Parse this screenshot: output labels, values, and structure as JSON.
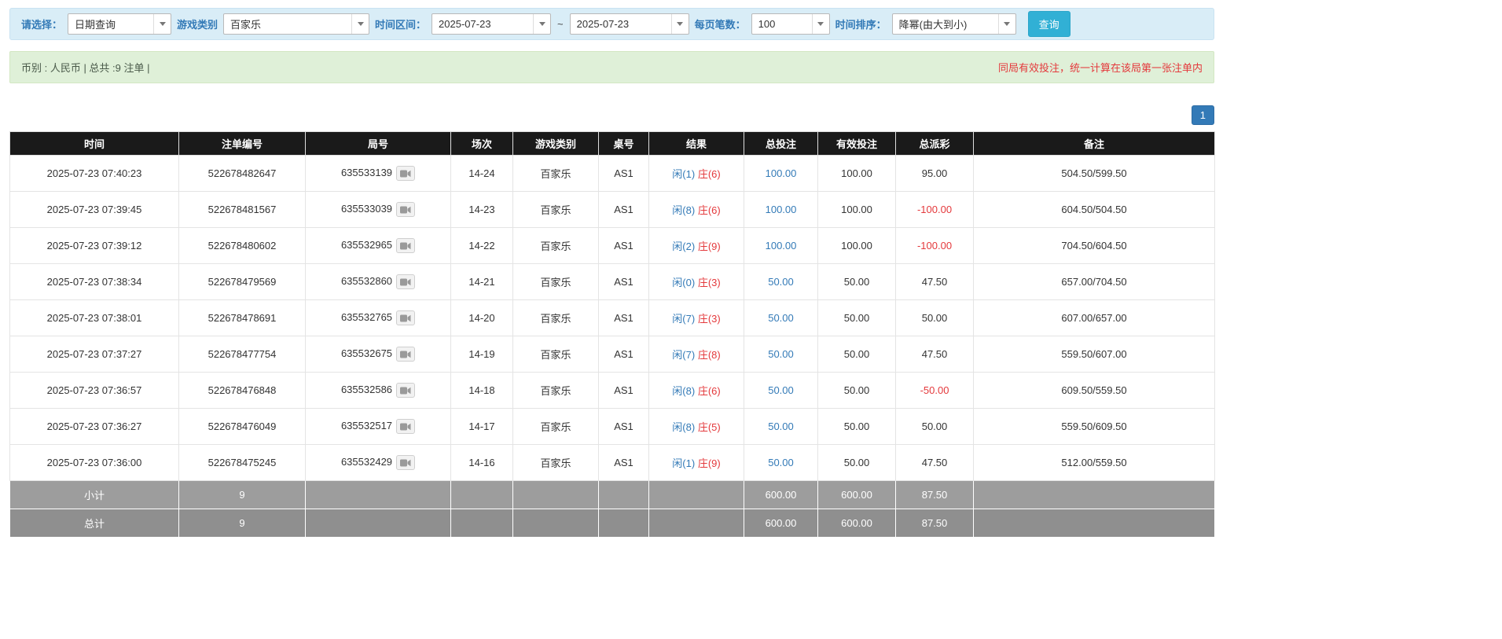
{
  "colors": {
    "accent_blue": "#337ab7",
    "status_red": "#e4393c",
    "button_cyan": "#31b0d5",
    "header_black": "#1a1a1a"
  },
  "filters": {
    "select_label": "请选择：",
    "select_value": "日期查询",
    "game_type_label": "游戏类别",
    "game_type_value": "百家乐",
    "time_range_label": "时间区间：",
    "date_from": "2025-07-23",
    "range_separator": "~",
    "date_to": "2025-07-23",
    "page_size_label": "每页笔数：",
    "page_size_value": "100",
    "sort_label": "时间排序：",
    "sort_value": "降幂(由大到小)",
    "search_button": "查询"
  },
  "summary": {
    "left": "币别 : 人民币 | 总共 :9 注单 |",
    "right": "同局有效投注，统一计算在该局第一张注单内"
  },
  "pagination": {
    "current": "1"
  },
  "table": {
    "headers": [
      "时间",
      "注单编号",
      "局号",
      "场次",
      "游戏类别",
      "桌号",
      "结果",
      "总投注",
      "有效投注",
      "总派彩",
      "备注"
    ],
    "rows": [
      {
        "time": "2025-07-23 07:40:23",
        "bet_id": "522678482647",
        "round_id": "635533139",
        "session": "14-24",
        "game": "百家乐",
        "table": "AS1",
        "player": "闲(1)",
        "banker": "庄(6)",
        "total_bet": "100.00",
        "valid_bet": "100.00",
        "payout": "95.00",
        "remark": "504.50/599.50"
      },
      {
        "time": "2025-07-23 07:39:45",
        "bet_id": "522678481567",
        "round_id": "635533039",
        "session": "14-23",
        "game": "百家乐",
        "table": "AS1",
        "player": "闲(8)",
        "banker": "庄(6)",
        "total_bet": "100.00",
        "valid_bet": "100.00",
        "payout": "-100.00",
        "remark": "604.50/504.50"
      },
      {
        "time": "2025-07-23 07:39:12",
        "bet_id": "522678480602",
        "round_id": "635532965",
        "session": "14-22",
        "game": "百家乐",
        "table": "AS1",
        "player": "闲(2)",
        "banker": "庄(9)",
        "total_bet": "100.00",
        "valid_bet": "100.00",
        "payout": "-100.00",
        "remark": "704.50/604.50"
      },
      {
        "time": "2025-07-23 07:38:34",
        "bet_id": "522678479569",
        "round_id": "635532860",
        "session": "14-21",
        "game": "百家乐",
        "table": "AS1",
        "player": "闲(0)",
        "banker": "庄(3)",
        "total_bet": "50.00",
        "valid_bet": "50.00",
        "payout": "47.50",
        "remark": "657.00/704.50"
      },
      {
        "time": "2025-07-23 07:38:01",
        "bet_id": "522678478691",
        "round_id": "635532765",
        "session": "14-20",
        "game": "百家乐",
        "table": "AS1",
        "player": "闲(7)",
        "banker": "庄(3)",
        "total_bet": "50.00",
        "valid_bet": "50.00",
        "payout": "50.00",
        "remark": "607.00/657.00"
      },
      {
        "time": "2025-07-23 07:37:27",
        "bet_id": "522678477754",
        "round_id": "635532675",
        "session": "14-19",
        "game": "百家乐",
        "table": "AS1",
        "player": "闲(7)",
        "banker": "庄(8)",
        "total_bet": "50.00",
        "valid_bet": "50.00",
        "payout": "47.50",
        "remark": "559.50/607.00"
      },
      {
        "time": "2025-07-23 07:36:57",
        "bet_id": "522678476848",
        "round_id": "635532586",
        "session": "14-18",
        "game": "百家乐",
        "table": "AS1",
        "player": "闲(8)",
        "banker": "庄(6)",
        "total_bet": "50.00",
        "valid_bet": "50.00",
        "payout": "-50.00",
        "remark": "609.50/559.50"
      },
      {
        "time": "2025-07-23 07:36:27",
        "bet_id": "522678476049",
        "round_id": "635532517",
        "session": "14-17",
        "game": "百家乐",
        "table": "AS1",
        "player": "闲(8)",
        "banker": "庄(5)",
        "total_bet": "50.00",
        "valid_bet": "50.00",
        "payout": "50.00",
        "remark": "559.50/609.50"
      },
      {
        "time": "2025-07-23 07:36:00",
        "bet_id": "522678475245",
        "round_id": "635532429",
        "session": "14-16",
        "game": "百家乐",
        "table": "AS1",
        "player": "闲(1)",
        "banker": "庄(9)",
        "total_bet": "50.00",
        "valid_bet": "50.00",
        "payout": "47.50",
        "remark": "512.00/559.50"
      }
    ],
    "subtotal": {
      "label": "小计",
      "count": "9",
      "total_bet": "600.00",
      "valid_bet": "600.00",
      "payout": "87.50"
    },
    "total": {
      "label": "总计",
      "count": "9",
      "total_bet": "600.00",
      "valid_bet": "600.00",
      "payout": "87.50"
    }
  }
}
